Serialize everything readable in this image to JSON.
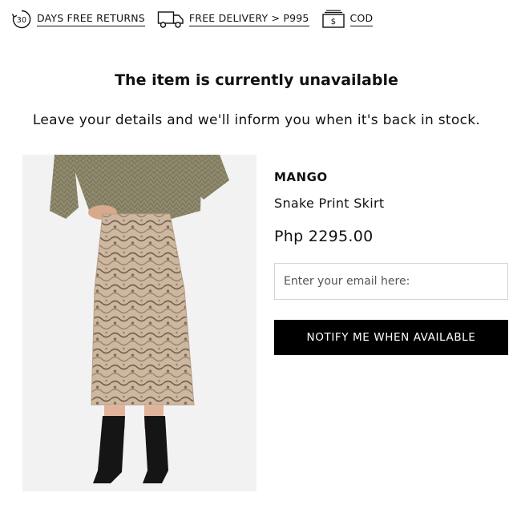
{
  "perks": {
    "returns_days": "30",
    "returns_label": "DAYS FREE RETURNS",
    "delivery_label": "FREE DELIVERY > P995",
    "cod_label": "COD",
    "cod_symbol": "$"
  },
  "message": {
    "title": "The item is currently unavailable",
    "subtitle": "Leave your details and we'll inform you when it's back in stock."
  },
  "product": {
    "brand": "MANGO",
    "name": "Snake Print Skirt",
    "price": "Php 2295.00"
  },
  "form": {
    "email_placeholder": "Enter your email here:",
    "email_value": "",
    "notify_label": "NOTIFY ME WHEN AVAILABLE"
  }
}
